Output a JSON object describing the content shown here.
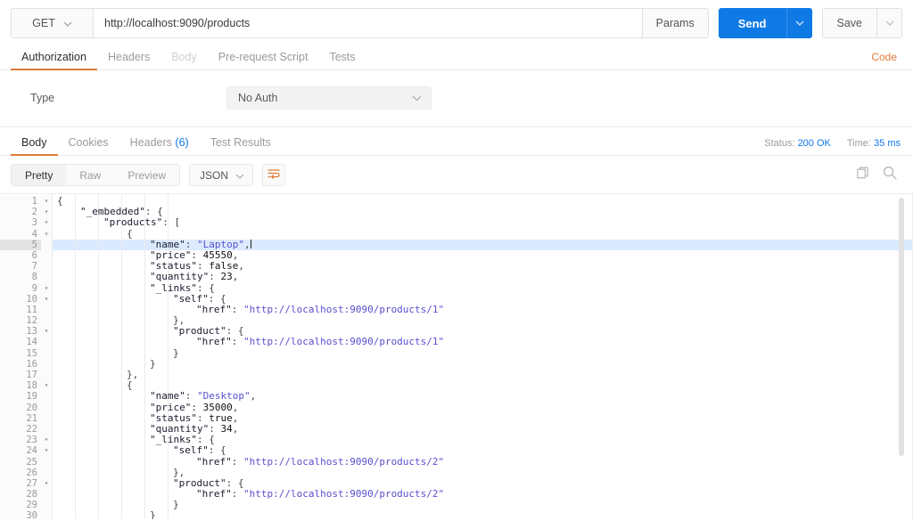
{
  "request": {
    "method": "GET",
    "url": "http://localhost:9090/products",
    "params_label": "Params",
    "send_label": "Send",
    "save_label": "Save",
    "tabs": [
      {
        "label": "Authorization",
        "state": "active"
      },
      {
        "label": "Headers",
        "state": "normal"
      },
      {
        "label": "Body",
        "state": "disabled"
      },
      {
        "label": "Pre-request Script",
        "state": "normal"
      },
      {
        "label": "Tests",
        "state": "normal"
      }
    ],
    "code_link": "Code"
  },
  "auth": {
    "type_label": "Type",
    "type_value": "No Auth"
  },
  "response": {
    "tabs": [
      {
        "label": "Body",
        "state": "active",
        "badge": ""
      },
      {
        "label": "Cookies",
        "state": "normal",
        "badge": ""
      },
      {
        "label": "Headers",
        "state": "normal",
        "badge": "(6)"
      },
      {
        "label": "Test Results",
        "state": "normal",
        "badge": ""
      }
    ],
    "status_label": "Status:",
    "status_value": "200 OK",
    "time_label": "Time:",
    "time_value": "35 ms",
    "view_modes": [
      {
        "label": "Pretty",
        "state": "active"
      },
      {
        "label": "Raw",
        "state": "normal"
      },
      {
        "label": "Preview",
        "state": "normal"
      }
    ],
    "format": "JSON",
    "wrap_icon": "word-wrap-icon",
    "copy_icon": "copy-icon",
    "search_icon": "search-icon"
  },
  "colors": {
    "accent_orange": "#e07b39",
    "accent_blue": "#0f7ae5",
    "string_purple": "#5a4fcf",
    "highlight_row": "#dbeafe"
  },
  "editor": {
    "highlighted_line": 5,
    "total_visible_lines": 30,
    "lines": [
      {
        "n": 1,
        "fold": true,
        "indent": 0,
        "tokens": [
          {
            "t": "p",
            "v": "{"
          }
        ]
      },
      {
        "n": 2,
        "fold": true,
        "indent": 1,
        "tokens": [
          {
            "t": "k",
            "v": "\"_embedded\""
          },
          {
            "t": "p",
            "v": ": {"
          }
        ]
      },
      {
        "n": 3,
        "fold": true,
        "indent": 2,
        "tokens": [
          {
            "t": "k",
            "v": "\"products\""
          },
          {
            "t": "p",
            "v": ": ["
          }
        ]
      },
      {
        "n": 4,
        "fold": true,
        "indent": 3,
        "tokens": [
          {
            "t": "p",
            "v": "{"
          }
        ]
      },
      {
        "n": 5,
        "fold": false,
        "indent": 4,
        "tokens": [
          {
            "t": "k",
            "v": "\"name\""
          },
          {
            "t": "p",
            "v": ": "
          },
          {
            "t": "s",
            "v": "\"Laptop\""
          },
          {
            "t": "p",
            "v": ","
          },
          {
            "t": "caret",
            "v": ""
          }
        ]
      },
      {
        "n": 6,
        "fold": false,
        "indent": 4,
        "tokens": [
          {
            "t": "k",
            "v": "\"price\""
          },
          {
            "t": "p",
            "v": ": "
          },
          {
            "t": "n",
            "v": "45550"
          },
          {
            "t": "p",
            "v": ","
          }
        ]
      },
      {
        "n": 7,
        "fold": false,
        "indent": 4,
        "tokens": [
          {
            "t": "k",
            "v": "\"status\""
          },
          {
            "t": "p",
            "v": ": "
          },
          {
            "t": "b",
            "v": "false"
          },
          {
            "t": "p",
            "v": ","
          }
        ]
      },
      {
        "n": 8,
        "fold": false,
        "indent": 4,
        "tokens": [
          {
            "t": "k",
            "v": "\"quantity\""
          },
          {
            "t": "p",
            "v": ": "
          },
          {
            "t": "n",
            "v": "23"
          },
          {
            "t": "p",
            "v": ","
          }
        ]
      },
      {
        "n": 9,
        "fold": true,
        "indent": 4,
        "tokens": [
          {
            "t": "k",
            "v": "\"_links\""
          },
          {
            "t": "p",
            "v": ": {"
          }
        ]
      },
      {
        "n": 10,
        "fold": true,
        "indent": 5,
        "tokens": [
          {
            "t": "k",
            "v": "\"self\""
          },
          {
            "t": "p",
            "v": ": {"
          }
        ]
      },
      {
        "n": 11,
        "fold": false,
        "indent": 6,
        "tokens": [
          {
            "t": "k",
            "v": "\"href\""
          },
          {
            "t": "p",
            "v": ": "
          },
          {
            "t": "s",
            "v": "\"http://localhost:9090/products/1\""
          }
        ]
      },
      {
        "n": 12,
        "fold": false,
        "indent": 5,
        "tokens": [
          {
            "t": "p",
            "v": "},"
          }
        ]
      },
      {
        "n": 13,
        "fold": true,
        "indent": 5,
        "tokens": [
          {
            "t": "k",
            "v": "\"product\""
          },
          {
            "t": "p",
            "v": ": {"
          }
        ]
      },
      {
        "n": 14,
        "fold": false,
        "indent": 6,
        "tokens": [
          {
            "t": "k",
            "v": "\"href\""
          },
          {
            "t": "p",
            "v": ": "
          },
          {
            "t": "s",
            "v": "\"http://localhost:9090/products/1\""
          }
        ]
      },
      {
        "n": 15,
        "fold": false,
        "indent": 5,
        "tokens": [
          {
            "t": "p",
            "v": "}"
          }
        ]
      },
      {
        "n": 16,
        "fold": false,
        "indent": 4,
        "tokens": [
          {
            "t": "p",
            "v": "}"
          }
        ]
      },
      {
        "n": 17,
        "fold": false,
        "indent": 3,
        "tokens": [
          {
            "t": "p",
            "v": "},"
          }
        ]
      },
      {
        "n": 18,
        "fold": true,
        "indent": 3,
        "tokens": [
          {
            "t": "p",
            "v": "{"
          }
        ]
      },
      {
        "n": 19,
        "fold": false,
        "indent": 4,
        "tokens": [
          {
            "t": "k",
            "v": "\"name\""
          },
          {
            "t": "p",
            "v": ": "
          },
          {
            "t": "s",
            "v": "\"Desktop\""
          },
          {
            "t": "p",
            "v": ","
          }
        ]
      },
      {
        "n": 20,
        "fold": false,
        "indent": 4,
        "tokens": [
          {
            "t": "k",
            "v": "\"price\""
          },
          {
            "t": "p",
            "v": ": "
          },
          {
            "t": "n",
            "v": "35000"
          },
          {
            "t": "p",
            "v": ","
          }
        ]
      },
      {
        "n": 21,
        "fold": false,
        "indent": 4,
        "tokens": [
          {
            "t": "k",
            "v": "\"status\""
          },
          {
            "t": "p",
            "v": ": "
          },
          {
            "t": "b",
            "v": "true"
          },
          {
            "t": "p",
            "v": ","
          }
        ]
      },
      {
        "n": 22,
        "fold": false,
        "indent": 4,
        "tokens": [
          {
            "t": "k",
            "v": "\"quantity\""
          },
          {
            "t": "p",
            "v": ": "
          },
          {
            "t": "n",
            "v": "34"
          },
          {
            "t": "p",
            "v": ","
          }
        ]
      },
      {
        "n": 23,
        "fold": true,
        "indent": 4,
        "tokens": [
          {
            "t": "k",
            "v": "\"_links\""
          },
          {
            "t": "p",
            "v": ": {"
          }
        ]
      },
      {
        "n": 24,
        "fold": true,
        "indent": 5,
        "tokens": [
          {
            "t": "k",
            "v": "\"self\""
          },
          {
            "t": "p",
            "v": ": {"
          }
        ]
      },
      {
        "n": 25,
        "fold": false,
        "indent": 6,
        "tokens": [
          {
            "t": "k",
            "v": "\"href\""
          },
          {
            "t": "p",
            "v": ": "
          },
          {
            "t": "s",
            "v": "\"http://localhost:9090/products/2\""
          }
        ]
      },
      {
        "n": 26,
        "fold": false,
        "indent": 5,
        "tokens": [
          {
            "t": "p",
            "v": "},"
          }
        ]
      },
      {
        "n": 27,
        "fold": true,
        "indent": 5,
        "tokens": [
          {
            "t": "k",
            "v": "\"product\""
          },
          {
            "t": "p",
            "v": ": {"
          }
        ]
      },
      {
        "n": 28,
        "fold": false,
        "indent": 6,
        "tokens": [
          {
            "t": "k",
            "v": "\"href\""
          },
          {
            "t": "p",
            "v": ": "
          },
          {
            "t": "s",
            "v": "\"http://localhost:9090/products/2\""
          }
        ]
      },
      {
        "n": 29,
        "fold": false,
        "indent": 5,
        "tokens": [
          {
            "t": "p",
            "v": "}"
          }
        ]
      },
      {
        "n": 30,
        "fold": false,
        "indent": 4,
        "tokens": [
          {
            "t": "p",
            "v": "}"
          }
        ]
      }
    ]
  }
}
